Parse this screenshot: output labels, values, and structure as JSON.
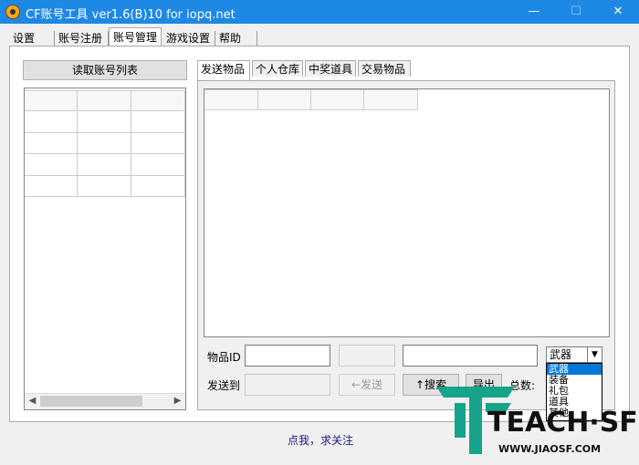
{
  "window": {
    "title": "CF账号工具 ver1.6(B)10 for iopq.net",
    "minimize_glyph": "—",
    "maximize_glyph": "☐",
    "close_glyph": "✕"
  },
  "main_tabs": [
    "设置",
    "账号注册",
    "账号管理",
    "游戏设置",
    "帮助"
  ],
  "active_main_tab": "账号管理",
  "left": {
    "read_button": "读取账号列表"
  },
  "right_tabs": [
    "发送物品",
    "个人仓库",
    "中奖道具",
    "交易物品"
  ],
  "active_right_tab": "发送物品",
  "form": {
    "item_id_label": "物品ID",
    "send_to_label": "发送到",
    "send_button": "←发送",
    "search_button": "↑搜索",
    "export_button": "导出",
    "total_label": "总数:",
    "category_selected": "武器",
    "category_options": [
      "武器",
      "装备",
      "礼包",
      "道具",
      "其他"
    ]
  },
  "footer": {
    "link": "点我，求关注"
  },
  "watermark": {
    "logo_text": "TEACH·SF",
    "url": "WWW.JIAOSF.COM"
  }
}
